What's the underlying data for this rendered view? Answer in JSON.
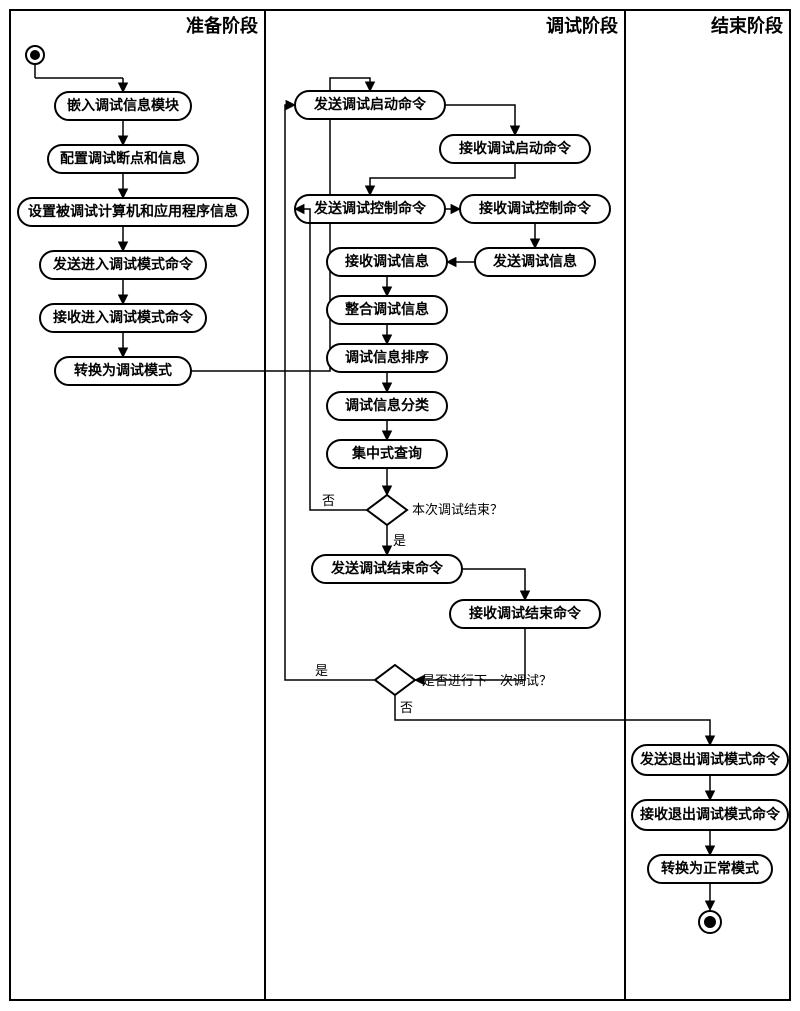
{
  "lanes": {
    "prepare": "准备阶段",
    "debug": "调试阶段",
    "end": "结束阶段"
  },
  "prepare": {
    "n1": "嵌入调试信息模块",
    "n2": "配置调试断点和信息",
    "n3": "设置被调试计算机和应用程序信息",
    "n4": "发送进入调试模式命令",
    "n5": "接收进入调试模式命令",
    "n6": "转换为调试模式"
  },
  "debug": {
    "d1": "发送调试启动命令",
    "d2": "接收调试启动命令",
    "d3": "发送调试控制命令",
    "d4": "接收调试控制命令",
    "d5": "发送调试信息",
    "d6": "接收调试信息",
    "d7": "整合调试信息",
    "d8": "调试信息排序",
    "d9": "调试信息分类",
    "d10": "集中式查询",
    "dec1": "本次调试结束？",
    "d11": "发送调试结束命令",
    "d12": "接收调试结束命令",
    "dec2": "是否进行下一次调试？",
    "yes": "是",
    "no": "否"
  },
  "end": {
    "e1": "发送退出调试模式命令",
    "e2": "接收退出调试模式命令",
    "e3": "转换为正常模式"
  }
}
